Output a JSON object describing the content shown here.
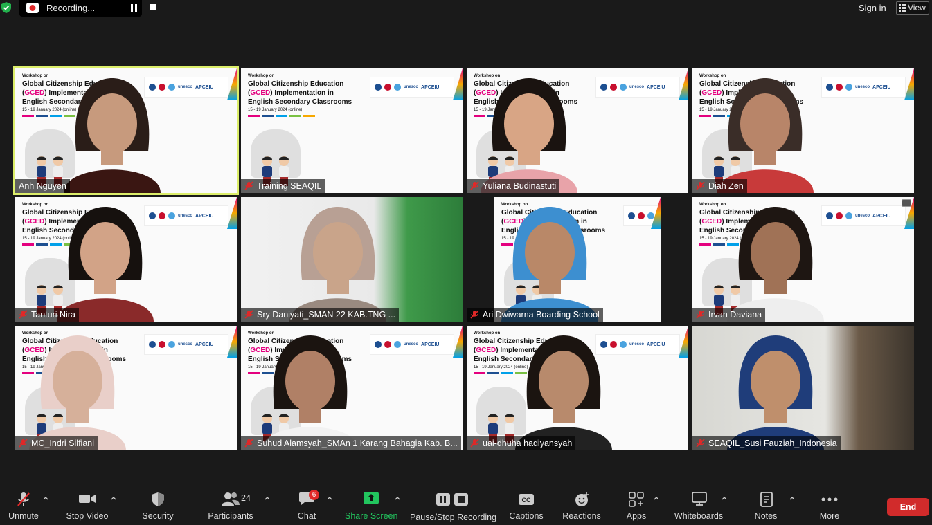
{
  "topbar": {
    "recording_label": "Recording...",
    "sign_in": "Sign in",
    "view": "View"
  },
  "banner": {
    "workshop": "Workshop on",
    "title_pre": "Global Citizenship Education (",
    "title_gced": "GCED",
    "title_post": ") Implementation in English Secondary Classrooms",
    "dates": "15 - 19 January 2024 (online)",
    "unesco": "unesco",
    "apceiu": "APCEIU"
  },
  "participants": [
    {
      "name": "Anh Nguyen",
      "muted": false,
      "active": true
    },
    {
      "name": "Training SEAQIL",
      "muted": true,
      "active": false
    },
    {
      "name": "Yuliana Budinastuti",
      "muted": true,
      "active": false
    },
    {
      "name": "Diah Zen",
      "muted": true,
      "active": false
    },
    {
      "name": "Tanturi Nira",
      "muted": true,
      "active": false
    },
    {
      "name": "Sry Daniyati_SMAN 22 KAB.TNG ...",
      "muted": true,
      "active": false
    },
    {
      "name": "Ari Dwiwarna Boarding School",
      "muted": true,
      "active": false
    },
    {
      "name": "Irvan Daviana",
      "muted": true,
      "active": false
    },
    {
      "name": "MC_Indri Silfiani",
      "muted": true,
      "active": false
    },
    {
      "name": "Suhud Alamsyah_SMAn 1 Karang Bahagia Kab. B...",
      "muted": true,
      "active": false
    },
    {
      "name": "uai-dhuha hadiyansyah",
      "muted": true,
      "active": false
    },
    {
      "name": "SEAQIL_Susi Fauziah_Indonesia",
      "muted": true,
      "active": false
    }
  ],
  "toolbar": {
    "unmute": "Unmute",
    "stop_video": "Stop Video",
    "security": "Security",
    "participants": "Participants",
    "participants_count": "24",
    "chat": "Chat",
    "chat_badge": "6",
    "share_screen": "Share Screen",
    "pause_stop_recording": "Pause/Stop Recording",
    "captions": "Captions",
    "reactions": "Reactions",
    "apps": "Apps",
    "whiteboards": "Whiteboards",
    "notes": "Notes",
    "more": "More",
    "end": "End"
  },
  "colors": {
    "active_speaker": "#dcee6a",
    "share_green": "#22c55e",
    "end_red": "#d12b2b",
    "badge_red": "#e02828"
  }
}
